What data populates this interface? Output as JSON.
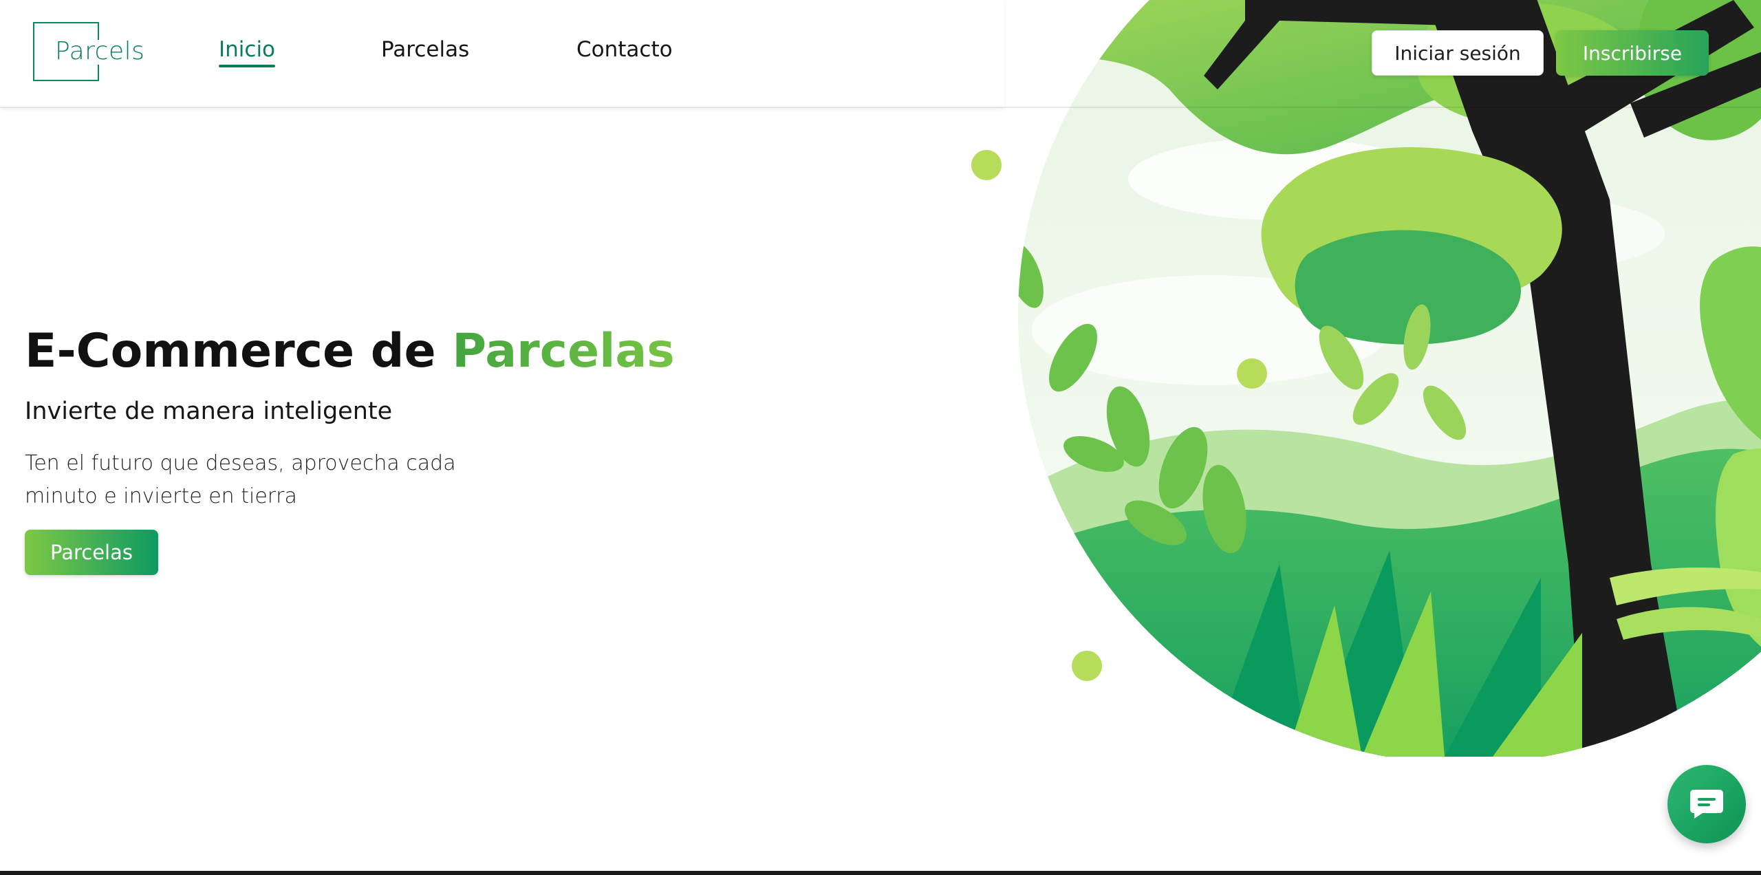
{
  "brand": {
    "logo_text": "Parcels"
  },
  "nav": {
    "items": [
      {
        "label": "Inicio",
        "active": true
      },
      {
        "label": "Parcelas",
        "active": false
      },
      {
        "label": "Contacto",
        "active": false
      }
    ]
  },
  "auth": {
    "login_label": "Iniciar sesión",
    "signup_label": "Inscribirse"
  },
  "hero": {
    "title_main": "E-Commerce de ",
    "title_accent": "Parcelas",
    "subtitle": "Invierte de manera inteligente",
    "description": "Ten el futuro que deseas, aprovecha cada minuto e invierte en tierra",
    "cta_label": "Parcelas"
  },
  "icons": {
    "chat": "chat-bubble-icon"
  },
  "colors": {
    "primary": "#0a7f56",
    "accent_light": "#7ec845",
    "accent_dark": "#0e9a62",
    "text": "#111111"
  }
}
